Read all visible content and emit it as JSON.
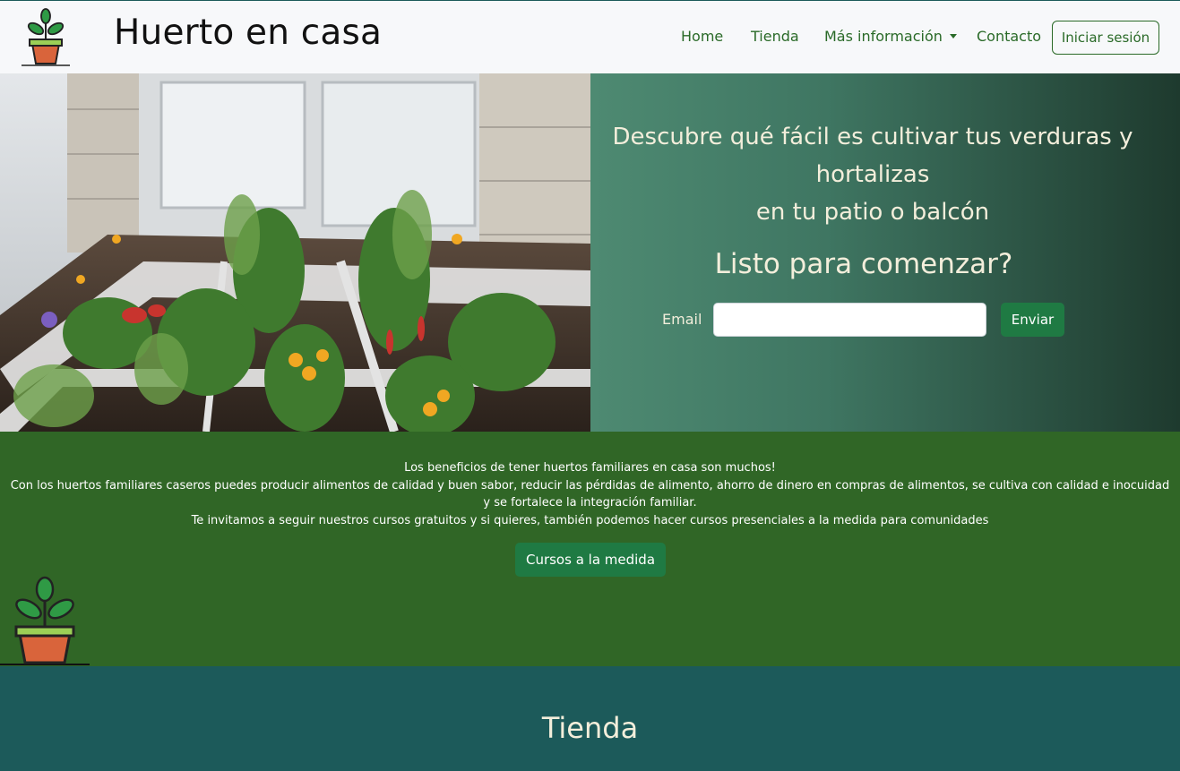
{
  "brand": {
    "name": "Huerto en casa",
    "logo_icon": "plant-pot-icon"
  },
  "nav": {
    "home": "Home",
    "store": "Tienda",
    "more_info": "Más información",
    "contact": "Contacto",
    "login": "Iniciar sesión"
  },
  "hero": {
    "image_icon": "garden-photo",
    "line1": "Descubre qué fácil es cultivar tus verduras y",
    "line2": "hortalizas",
    "line3": "en tu patio o balcón",
    "cta": "Listo para comenzar?",
    "email_label": "Email",
    "email_value": "",
    "send_label": "Enviar"
  },
  "benefits": {
    "line1": "Los beneficios de tener huertos familiares en casa son muchos!",
    "line2": "Con los huertos familiares caseros puedes producir alimentos de calidad y buen sabor, reducir las pérdidas de alimento, ahorro de dinero en compras de alimentos, se cultiva con calidad e inocuidad y se fortalece la integración familiar.",
    "line3": "Te invitamos a seguir nuestros cursos gratuitos y si quieres, también podemos hacer cursos presenciales a la medida para comunidades",
    "button": "Cursos a la medida",
    "illustration_icon": "plant-pot-icon"
  },
  "store": {
    "title": "Tienda"
  },
  "colors": {
    "navbar_bg": "#f7f8fa",
    "link_green": "#2a6a28",
    "benefits_bg": "#306626",
    "button_green": "#1f7a43",
    "store_bg": "#1c5a5a",
    "cream_text": "#f3eedb"
  }
}
